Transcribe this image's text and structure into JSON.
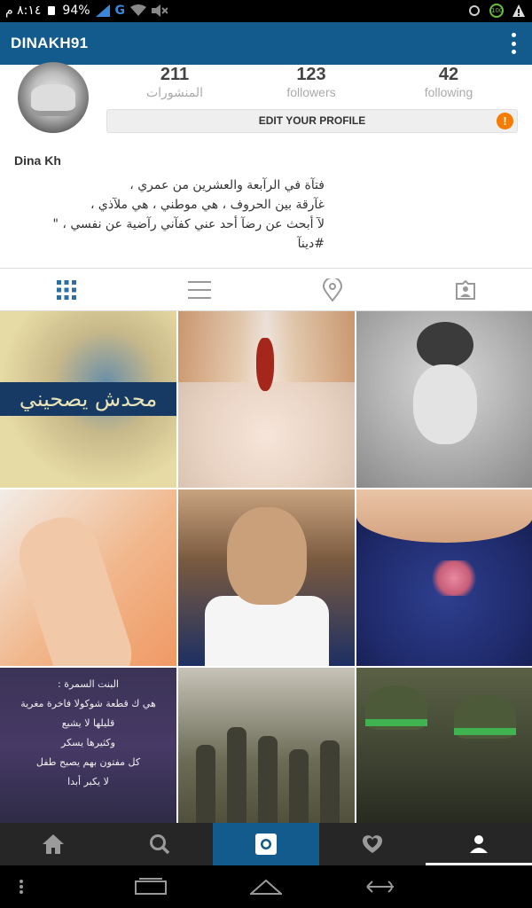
{
  "status_bar": {
    "time": "٨:١٤ م",
    "battery": "94%",
    "network": "G",
    "badge": "100"
  },
  "app_bar": {
    "username": "DINAKH91"
  },
  "profile": {
    "stats": [
      {
        "value": "211",
        "label": "المنشورات"
      },
      {
        "value": "123",
        "label": "followers"
      },
      {
        "value": "42",
        "label": "following"
      }
    ],
    "edit_button": "EDIT YOUR PROFILE",
    "warning_glyph": "!",
    "name": "Dina Kh",
    "bio_lines": [
      "فتآة في الرآبعة والعشرين من عمري ،",
      "غآرقة بين الحروف ، هي موطني ، هي ملآذي ،",
      "لآ أبحث عن رضآ أحد عني كفآني رآضية عن نفسي ، \"",
      "#دينآ"
    ]
  },
  "tabs": [
    {
      "name": "grid",
      "icon": "grid-icon",
      "active": true
    },
    {
      "name": "list",
      "icon": "list-icon",
      "active": false
    },
    {
      "name": "map",
      "icon": "location-pin-icon",
      "active": false
    },
    {
      "name": "tagged",
      "icon": "tagged-photos-icon",
      "active": false
    }
  ],
  "photos": {
    "p1_caption": "محدش يصحيني",
    "p7_lines": [
      "البنت السمرة :",
      "هي ك قطعة شوكولا فاخرة مغرية",
      "قليلها لا يشبع",
      "وكثيرها يسكر",
      "كل مفتون بهم يصبح طفل",
      "لا يكبر أبدا"
    ]
  },
  "bottom_nav": [
    {
      "icon": "home-icon"
    },
    {
      "icon": "search-icon"
    },
    {
      "icon": "camera-icon",
      "highlighted": true
    },
    {
      "icon": "activity-heart-icon"
    },
    {
      "icon": "profile-icon",
      "selected": true
    }
  ],
  "colors": {
    "brand": "#135a8d",
    "warning": "#f57c00",
    "nav_bg": "#262626"
  }
}
